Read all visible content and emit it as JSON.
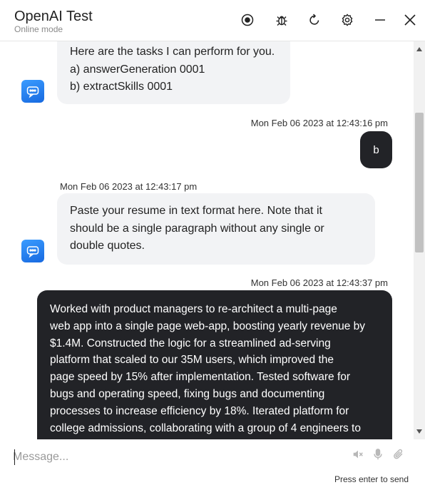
{
  "header": {
    "title": "OpenAI Test",
    "subtitle": "Online mode",
    "icons": [
      "record-icon",
      "bug-icon",
      "refresh-icon",
      "settings-icon",
      "minimize-icon",
      "close-icon"
    ]
  },
  "messages": [
    {
      "sender": "bot",
      "lines": [
        "Here are the tasks I can perform for you.",
        "a) answerGeneration 0001",
        "b) extractSkills 0001"
      ]
    },
    {
      "sender": "user",
      "timestamp": "Mon Feb 06 2023 at 12:43:16 pm",
      "text": "b"
    },
    {
      "sender": "bot",
      "timestamp": "Mon Feb 06 2023 at 12:43:17 pm",
      "lines": [
        "Paste your resume in text format here. Note that it",
        "should be a single paragraph without any single or",
        "double quotes."
      ]
    },
    {
      "sender": "user",
      "timestamp": "Mon Feb 06 2023 at 12:43:37 pm",
      "lines": [
        "Worked with product managers to re-architect a multi-page",
        "web app into a single page web-app, boosting yearly revenue by",
        "$1.4M. Constructed the logic for a streamlined ad-serving",
        "platform that scaled to our 35M users, which improved the",
        "page speed by 15% after implementation. Tested software for",
        "bugs and operating speed, fixing bugs and documenting",
        "processes to increase efficiency by 18%. Iterated platform for",
        "college admissions, collaborating with a group of 4 engineers to"
      ]
    }
  ],
  "composer": {
    "placeholder": "Message...",
    "hint": "Press enter to send",
    "icons": [
      "speaker-muted-icon",
      "microphone-icon",
      "attachment-icon"
    ]
  },
  "colors": {
    "bot_bubble": "#f2f3f5",
    "user_bubble": "#222327",
    "avatar_accent": "#1f7bf0"
  }
}
